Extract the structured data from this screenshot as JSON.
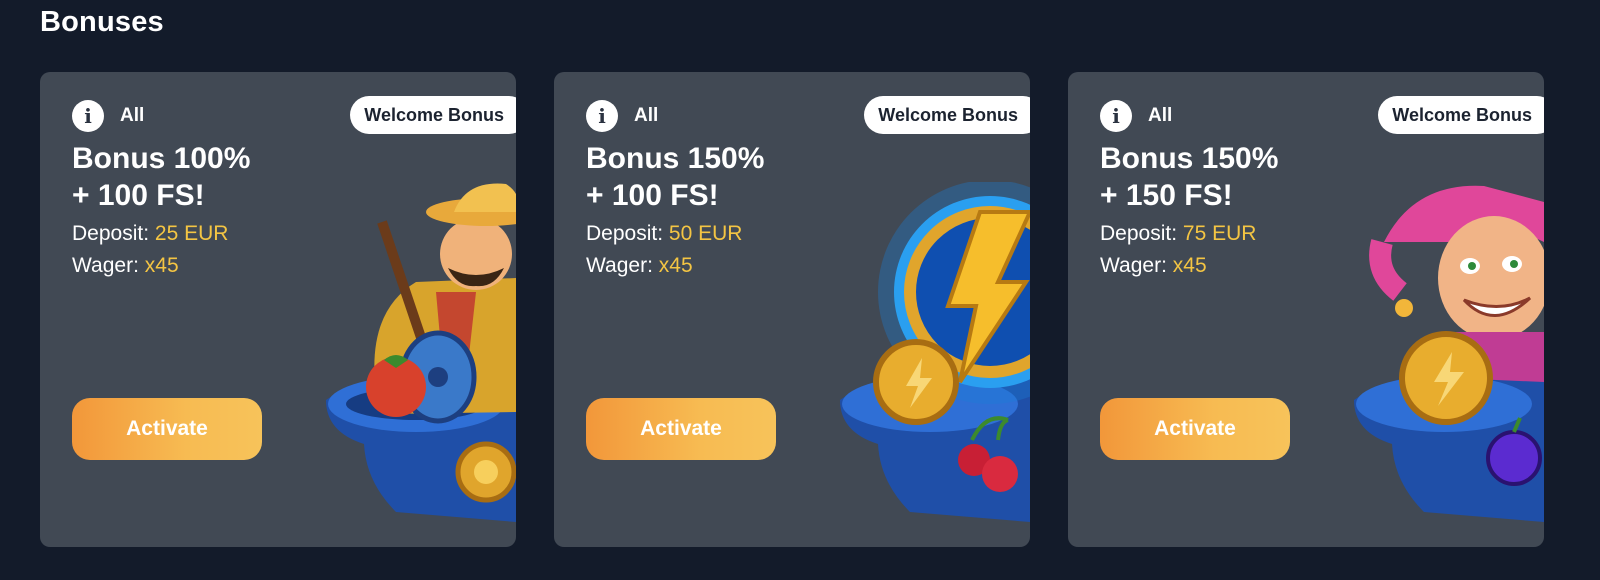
{
  "page": {
    "title": "Bonuses"
  },
  "cards": [
    {
      "category": "All",
      "badge": "Welcome Bonus",
      "title_line1": "Bonus 100%",
      "title_line2": "+ 100 FS!",
      "deposit_label": "Deposit:",
      "deposit_value": "25 EUR",
      "wager_label": "Wager:",
      "wager_value": "x45",
      "button": "Activate",
      "illustration": "mariachi-guitar-hat"
    },
    {
      "category": "All",
      "badge": "Welcome Bonus",
      "title_line1": "Bonus 150%",
      "title_line2": "+ 100 FS!",
      "deposit_label": "Deposit:",
      "deposit_value": "50 EUR",
      "wager_label": "Wager:",
      "wager_value": "x45",
      "button": "Activate",
      "illustration": "lightning-coin-hat"
    },
    {
      "category": "All",
      "badge": "Welcome Bonus",
      "title_line1": "Bonus 150%",
      "title_line2": "+ 150 FS!",
      "deposit_label": "Deposit:",
      "deposit_value": "75 EUR",
      "wager_label": "Wager:",
      "wager_value": "x45",
      "button": "Activate",
      "illustration": "jester-coin-hat"
    }
  ],
  "colors": {
    "background": "#131b2a",
    "card": "#414954",
    "highlight": "#f4c543",
    "button_start": "#f2973a",
    "button_end": "#f7c35a"
  }
}
